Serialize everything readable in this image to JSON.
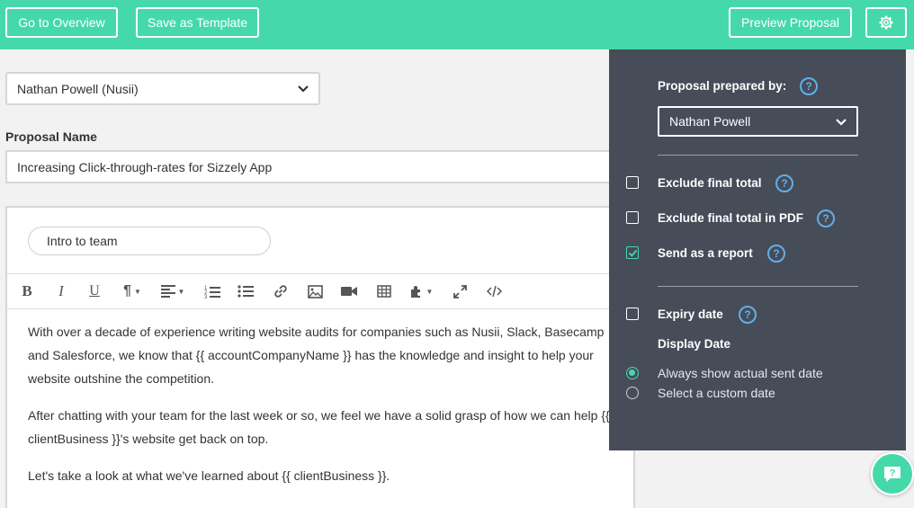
{
  "topbar": {
    "overview_label": "Go to Overview",
    "template_label": "Save as Template",
    "preview_label": "Preview Proposal",
    "gear_icon": "gear-icon",
    "bg_color": "#45d9aa"
  },
  "client_select": {
    "value": "Nathan Powell (Nusii)"
  },
  "proposal_name": {
    "label": "Proposal Name",
    "value": "Increasing Click-through-rates for Sizzely App"
  },
  "editor": {
    "section_title": "Intro to team",
    "toolbar": [
      "bold",
      "italic",
      "underline",
      "paragraph",
      "align",
      "ordered-list",
      "unordered-list",
      "link",
      "image",
      "video",
      "table",
      "plugin",
      "fullscreen",
      "code"
    ],
    "paragraphs": [
      "With over a decade of experience writing website audits for companies such as Nusii, Slack, Basecamp and Salesforce, we know that {{ accountCompanyName }} has the knowledge and insight to help your website outshine the competition.",
      "After chatting with your team for the last week or so, we feel we have a solid grasp of how we can help {{ clientBusiness }}'s website get back on top.",
      "Let's take a look at what we've learned about {{ clientBusiness }}."
    ]
  },
  "settings": {
    "prepared_by_label": "Proposal prepared by:",
    "prepared_by_value": "Nathan Powell",
    "exclude_total": {
      "label": "Exclude final total",
      "checked": false
    },
    "exclude_total_pdf": {
      "label": "Exclude final total in PDF",
      "checked": false
    },
    "send_report": {
      "label": "Send as a report",
      "checked": true
    },
    "expiry": {
      "label": "Expiry date",
      "checked": false
    },
    "display_date_label": "Display Date",
    "radio_actual": "Always show actual sent date",
    "radio_custom": "Select a custom date",
    "selected_radio": "actual",
    "help_glyph": "?",
    "panel_color": "#474c59",
    "accent_color": "#45d9aa"
  },
  "chat": {
    "icon": "chat-help-icon"
  }
}
